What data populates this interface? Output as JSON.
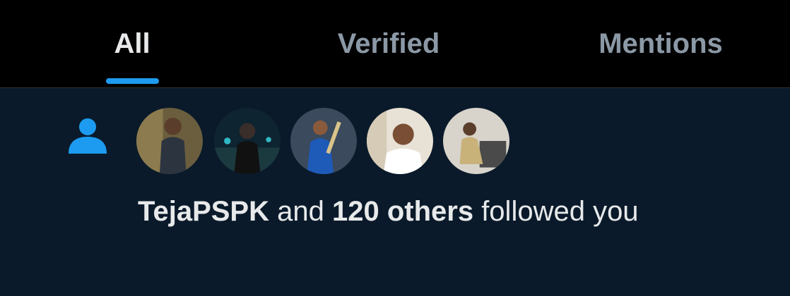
{
  "tabs": [
    {
      "label": "All",
      "active": true
    },
    {
      "label": "Verified",
      "active": false
    },
    {
      "label": "Mentions",
      "active": false
    }
  ],
  "notification": {
    "icon": "person-icon",
    "avatars_count_shown": 5,
    "user": "TejaPSPK",
    "connector": " and ",
    "others": "120 others",
    "action": " followed you"
  },
  "colors": {
    "accent": "#1d9bf0",
    "background_top": "#000000",
    "background_notification": "#0a1a2a",
    "text_primary": "#e7e9ea",
    "text_secondary": "#8b98a5"
  }
}
